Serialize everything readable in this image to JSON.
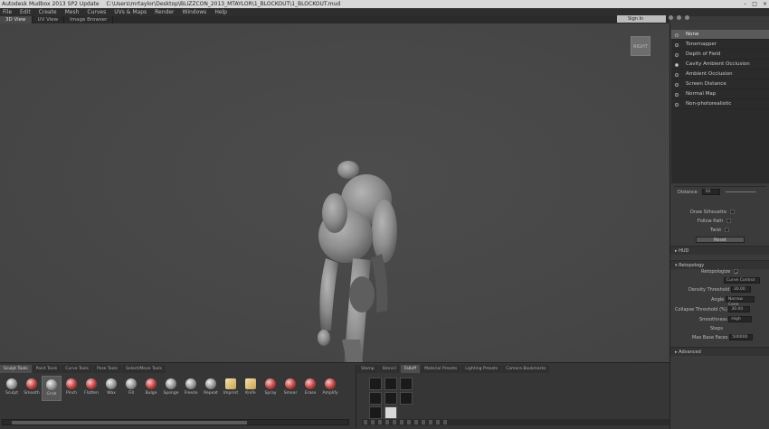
{
  "window": {
    "title": "Autodesk Mudbox 2013 SP2 Update",
    "path": "C:\\Users\\mrtaylor\\Desktop\\BLIZZCON_2013_MTAYLOR\\1_BLOCKOUT\\1_BLOCKOUT.mud"
  },
  "menu": [
    "File",
    "Edit",
    "Create",
    "Mesh",
    "Curves",
    "UVs & Maps",
    "Render",
    "Windows",
    "Help"
  ],
  "view_tabs": [
    "3D View",
    "UV View",
    "Image Browser"
  ],
  "signin": "Sign In",
  "viewcube_label": "RIGHT",
  "viewport_filters": [
    {
      "label": "None",
      "selected": true,
      "on": false
    },
    {
      "label": "Tonemapper",
      "selected": false,
      "on": false
    },
    {
      "label": "Depth of Field",
      "selected": false,
      "on": false
    },
    {
      "label": "Cavity Ambient Occlusion",
      "selected": false,
      "on": true
    },
    {
      "label": "Ambient Occlusion",
      "selected": false,
      "on": false
    },
    {
      "label": "Screen Distance",
      "selected": false,
      "on": false
    },
    {
      "label": "Normal Map",
      "selected": false,
      "on": false
    },
    {
      "label": "Non-photorealistic",
      "selected": false,
      "on": false
    }
  ],
  "panel": {
    "distance_label": "Distance",
    "distance_value": "50",
    "silhouette_label": "Draw Silhouette",
    "follow_path_label": "Follow Path",
    "twist_label": "Twist",
    "reset_label": "Reset",
    "section_hud": "HUD",
    "section_retopo": "Retopology",
    "retopo_check_label": "Retopologize",
    "mode_value": "Curve Control",
    "density_label": "Density Threshold",
    "density_value": "30.00",
    "angle_label": "Angle",
    "angle_value": "Narrow Cone",
    "collapse_label": "Collapse Threshold (%)",
    "collapse_value": "30.00",
    "smoothness_label": "Smoothness",
    "smoothness_value": "High",
    "steps_label": "Steps",
    "maxfaces_label": "Max Base Faces",
    "maxfaces_value": "500000",
    "advanced_label": "Advanced"
  },
  "tool_tabs": [
    "Sculpt Tools",
    "Paint Tools",
    "Curve Tools",
    "Pose Tools",
    "Select/Move Tools"
  ],
  "tools": [
    {
      "label": "Sculpt",
      "style": "ball"
    },
    {
      "label": "Smooth",
      "style": "red"
    },
    {
      "label": "Grab",
      "style": "ball",
      "selected": true
    },
    {
      "label": "Pinch",
      "style": "red"
    },
    {
      "label": "Flatten",
      "style": "red"
    },
    {
      "label": "Wax",
      "style": "ball"
    },
    {
      "label": "Fill",
      "style": "ball"
    },
    {
      "label": "Bulge",
      "style": "red"
    },
    {
      "label": "Sponge",
      "style": "ball"
    },
    {
      "label": "Freeze",
      "style": "ball"
    },
    {
      "label": "Repeat",
      "style": "ball"
    },
    {
      "label": "Imprint",
      "style": "box"
    },
    {
      "label": "Knife",
      "style": "box"
    },
    {
      "label": "Spray",
      "style": "red"
    },
    {
      "label": "Smear",
      "style": "red"
    },
    {
      "label": "Erase",
      "style": "red"
    },
    {
      "label": "Amplify",
      "style": "red"
    }
  ],
  "stamp_tabs": [
    "Stamp",
    "Stencil",
    "Falloff",
    "Material Presets",
    "Lighting Presets",
    "Camera Bookmarks"
  ]
}
